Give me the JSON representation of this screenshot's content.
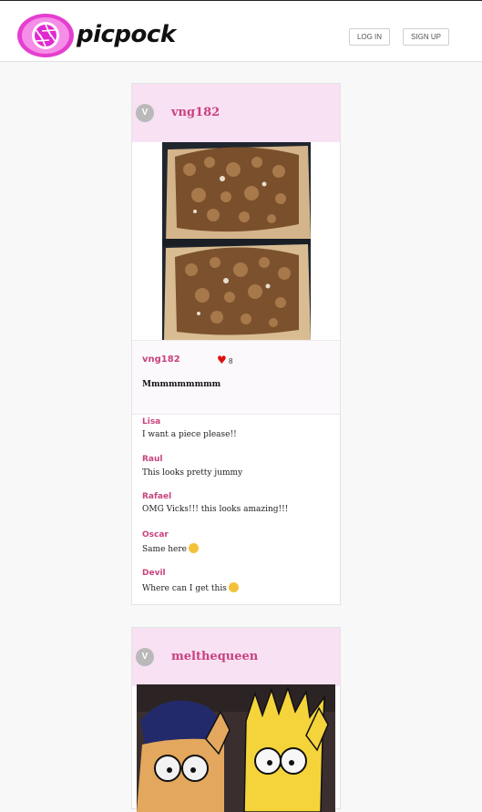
{
  "header": {
    "brand": "picpock",
    "login_label": "LOG IN",
    "signup_label": "SIGN UP"
  },
  "posts": [
    {
      "avatar_letter": "V",
      "username": "vng182",
      "poster_name": "vng182",
      "like_count": "8",
      "caption": "Mmmmmmmmm",
      "comments": [
        {
          "author": "Lisa",
          "text": "I want a piece please!!"
        },
        {
          "author": "Raul",
          "text": "This looks pretty jummy"
        },
        {
          "author": "Rafael",
          "text": "OMG Vicks!!! this looks amazing!!!"
        },
        {
          "author": "Oscar",
          "text": "Same here"
        },
        {
          "author": "Devil",
          "text": "Where can I get this"
        }
      ]
    },
    {
      "avatar_letter": "V",
      "username": "melthequeen"
    }
  ],
  "icons": {
    "logo": "camera-aperture-icon",
    "like": "heart-icon",
    "emoji_clap": "clapping-hands-emoji",
    "emoji_smile": "smiling-face-emoji"
  },
  "colors": {
    "accent": "#c8427f",
    "logo_pink": "#e02ad0",
    "card_header": "#f9e1f4",
    "heart": "#e01010"
  }
}
